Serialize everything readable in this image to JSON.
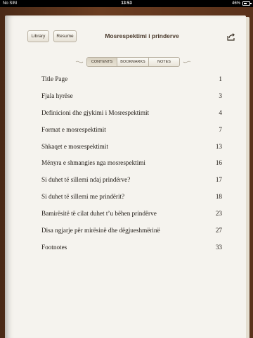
{
  "status_bar": {
    "carrier": "No SIM",
    "time": "13:53",
    "battery": "46%"
  },
  "toolbar": {
    "library_label": "Library",
    "resume_label": "Resume",
    "book_title": "Mosrespektimi i prinderve",
    "share_icon": "share-icon"
  },
  "tabs": {
    "contents": "CONTENTS",
    "bookmarks": "BOOKMARKS",
    "notes": "NOTES",
    "selected": "CONTENTS"
  },
  "toc": [
    {
      "title": "Title Page",
      "page": "1"
    },
    {
      "title": "Fjala hyrëse",
      "page": "3"
    },
    {
      "title": "Definicioni dhe gjykimi i Mosrespektimit",
      "page": "4"
    },
    {
      "title": "Format e mosrespektimit",
      "page": "7"
    },
    {
      "title": "Shkaqet e mosrespektimit",
      "page": "13"
    },
    {
      "title": "Mënyra e shmangies nga mosrespektimi",
      "page": "16"
    },
    {
      "title": "Si duhet të sillemi ndaj prindërve?",
      "page": "17"
    },
    {
      "title": "Si duhet të sillemi me prindërit?",
      "page": "18"
    },
    {
      "title": "Bamirësitë të cilat duhet t’u bëhen prindërve",
      "page": "23"
    },
    {
      "title": "Disa ngjarje për mirësinë dhe dëgjueshmërinë",
      "page": "27"
    },
    {
      "title": "Footnotes",
      "page": "33"
    }
  ]
}
